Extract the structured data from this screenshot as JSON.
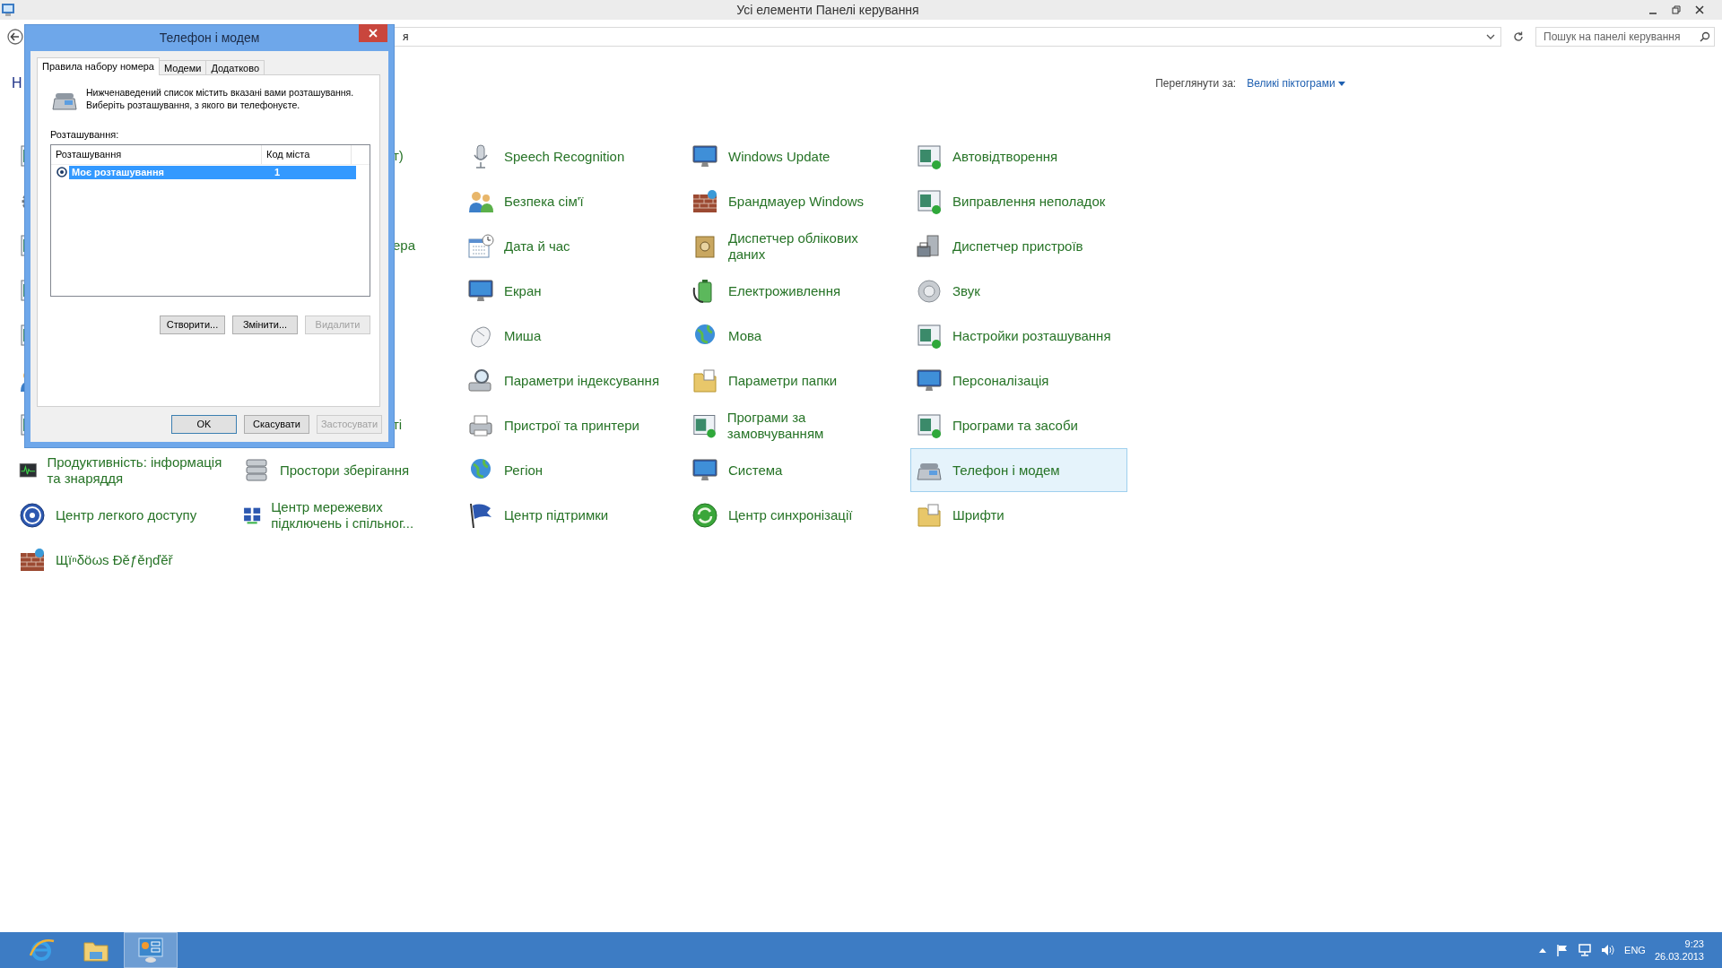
{
  "window": {
    "title": "Усі елементи Панелі керування"
  },
  "address_bar": {
    "value": "я"
  },
  "search": {
    "placeholder": "Пошук на панелі керування"
  },
  "heading": "Н",
  "view_by": {
    "label": "Переглянути за:",
    "value": "Великі піктограми"
  },
  "items": [
    {
      "kind": "covered"
    },
    {
      "kind": "fragment",
      "label": "т)"
    },
    {
      "kind": "item",
      "label": "Speech Recognition",
      "selected": false
    },
    {
      "kind": "item",
      "label": "Windows Update",
      "selected": false
    },
    {
      "kind": "item",
      "label": "Автовідтворення",
      "selected": false
    },
    {
      "kind": "covered"
    },
    {
      "kind": "hidden"
    },
    {
      "kind": "item",
      "label": "Безпека сім'ї",
      "selected": false
    },
    {
      "kind": "item",
      "label": "Брандмауер Windows",
      "selected": false
    },
    {
      "kind": "item",
      "label": "Виправлення неполадок",
      "selected": false
    },
    {
      "kind": "covered"
    },
    {
      "kind": "fragment",
      "label": "ера"
    },
    {
      "kind": "item",
      "label": "Дата й час",
      "selected": false
    },
    {
      "kind": "item",
      "label": "Диспетчер облікових даних",
      "selected": false
    },
    {
      "kind": "item",
      "label": "Диспетчер пристроїв",
      "selected": false
    },
    {
      "kind": "covered"
    },
    {
      "kind": "hidden"
    },
    {
      "kind": "item",
      "label": "Екран",
      "selected": false
    },
    {
      "kind": "item",
      "label": "Електроживлення",
      "selected": false
    },
    {
      "kind": "item",
      "label": "Звук",
      "selected": false
    },
    {
      "kind": "covered"
    },
    {
      "kind": "hidden"
    },
    {
      "kind": "item",
      "label": "Миша",
      "selected": false
    },
    {
      "kind": "item",
      "label": "Мова",
      "selected": false
    },
    {
      "kind": "item",
      "label": "Настройки розташування",
      "selected": false
    },
    {
      "kind": "covered"
    },
    {
      "kind": "hidden"
    },
    {
      "kind": "item",
      "label": "Параметри індексування",
      "selected": false
    },
    {
      "kind": "item",
      "label": "Параметри папки",
      "selected": false
    },
    {
      "kind": "item",
      "label": "Персоналізація",
      "selected": false
    },
    {
      "kind": "covered"
    },
    {
      "kind": "fragment",
      "label": "ті"
    },
    {
      "kind": "item",
      "label": "Пристрої та принтери",
      "selected": false
    },
    {
      "kind": "item",
      "label": "Програми за замовчуванням",
      "selected": false
    },
    {
      "kind": "item",
      "label": "Програми та засоби",
      "selected": false
    },
    {
      "kind": "item",
      "label": "Продуктивність: інформація та знаряддя",
      "selected": false
    },
    {
      "kind": "item",
      "label": "Простори зберігання",
      "selected": false
    },
    {
      "kind": "item",
      "label": "Регіон",
      "selected": false
    },
    {
      "kind": "item",
      "label": "Система",
      "selected": false
    },
    {
      "kind": "item",
      "label": "Телефон і модем",
      "selected": true
    },
    {
      "kind": "item",
      "label": "Центр легкого доступу",
      "selected": false
    },
    {
      "kind": "item",
      "label": "Центр мережевих підключень і спільног...",
      "selected": false
    },
    {
      "kind": "item",
      "label": "Центр підтримки",
      "selected": false
    },
    {
      "kind": "item",
      "label": "Центр синхронізації",
      "selected": false
    },
    {
      "kind": "item",
      "label": "Шрифти",
      "selected": false
    },
    {
      "kind": "item",
      "label": "Щїⁿδöωs Ðěƒěŋďěř",
      "selected": false
    }
  ],
  "dialog": {
    "title": "Телефон і модем",
    "tabs": [
      {
        "label": "Правила набору номера",
        "selected": true
      },
      {
        "label": "Модеми",
        "selected": false
      },
      {
        "label": "Додатково",
        "selected": false
      }
    ],
    "description": "Нижченаведений список містить вказані вами розташування.\nВиберіть розташування, з якого ви телефонуєте.",
    "list_label": "Розташування:",
    "columns": [
      "Розташування",
      "Код міста"
    ],
    "rows": [
      {
        "location": "Моє розташування",
        "area_code": "1",
        "selected": true
      }
    ],
    "list_buttons": [
      {
        "label": "Створити...",
        "disabled": false
      },
      {
        "label": "Змінити...",
        "disabled": false
      },
      {
        "label": "Видалити",
        "disabled": true
      }
    ],
    "buttons": [
      {
        "label": "OK",
        "default": true,
        "disabled": false
      },
      {
        "label": "Скасувати",
        "default": false,
        "disabled": false
      },
      {
        "label": "Застосувати",
        "default": false,
        "disabled": true
      }
    ]
  },
  "taskbar": {
    "apps": [
      {
        "selected": false
      },
      {
        "selected": false
      },
      {
        "selected": true
      }
    ],
    "language": "ENG",
    "time": "9:23",
    "date": "26.03.2013"
  }
}
